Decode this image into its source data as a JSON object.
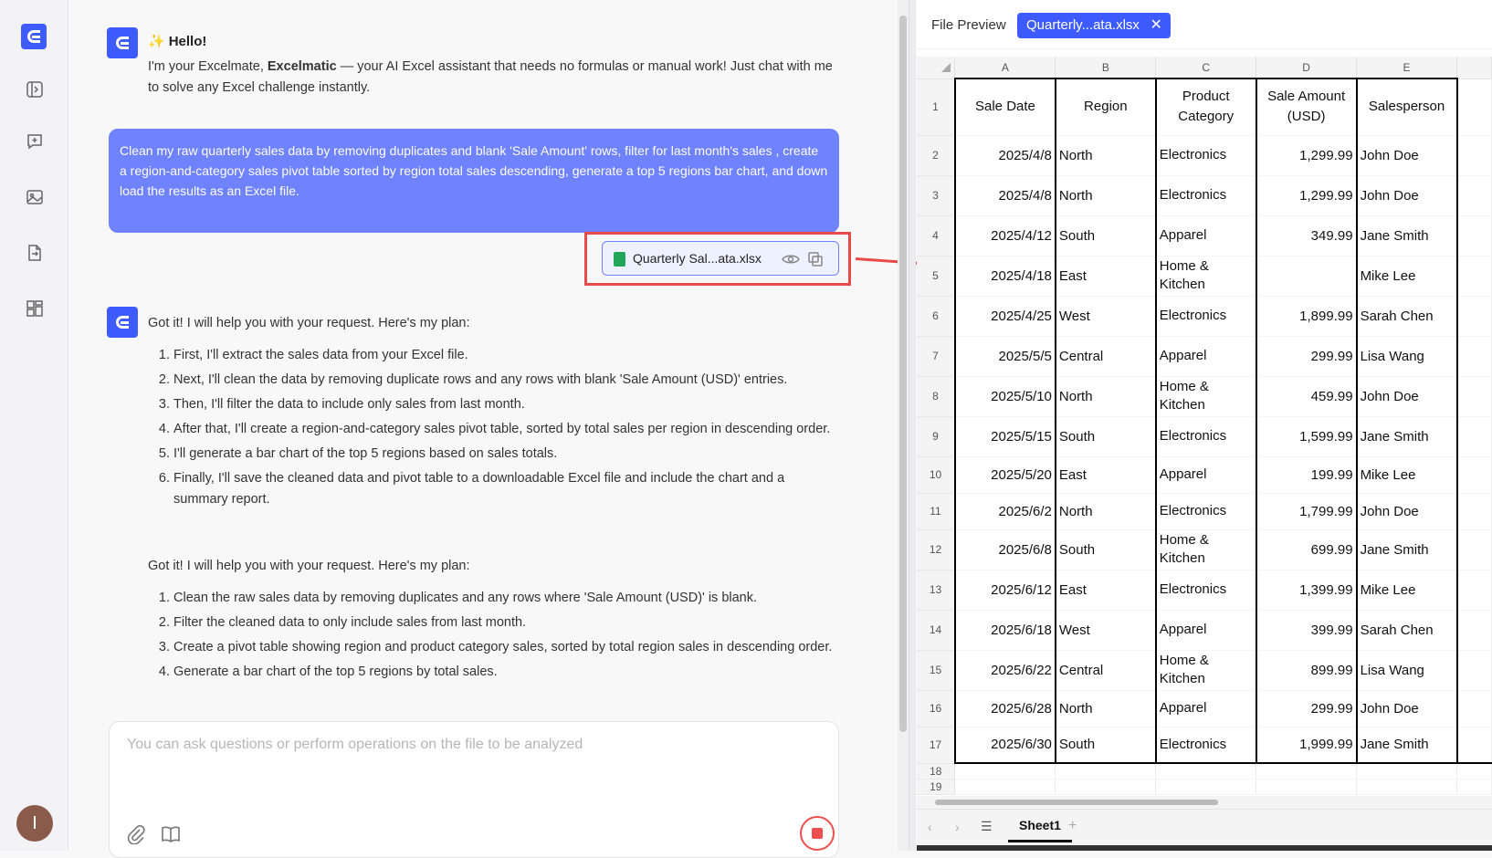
{
  "chat": {
    "hello_title": "Hello!",
    "hello_pre": "I'm your Excelmate, ",
    "hello_brand": "Excelmatic",
    "hello_post": " — your AI Excel assistant that needs no formulas or manual work! Just chat with me to solve any Excel challenge instantly.",
    "user_message": "Clean my raw quarterly sales data by removing duplicates and blank 'Sale Amount' rows, filter for last month's sales , create a region-and-category sales pivot table sorted by region total sales descending, generate a top 5 regions bar chart, and download the results as an Excel file.",
    "attached_file": "Quarterly Sal...ata.xlsx",
    "plan1_intro": "Got it! I will help you with your request. Here's my plan:",
    "plan1_items": [
      "First, I'll extract the sales data from your Excel file.",
      "Next, I'll clean the data by removing duplicate rows and any rows with blank 'Sale Amount (USD)' entries.",
      "Then, I'll filter the data to include only sales from last month.",
      "After that, I'll create a region-and-category sales pivot table, sorted by total sales per region in descending order.",
      "I'll generate a bar chart of the top 5 regions based on sales totals.",
      "Finally, I'll save the cleaned data and pivot table to a downloadable Excel file and include the chart and a summary report."
    ],
    "plan2_intro": "Got it! I will help you with your request. Here's my plan:",
    "plan2_items": [
      "Clean the raw sales data by removing duplicates and any rows where 'Sale Amount (USD)' is blank.",
      "Filter the cleaned data to only include sales from last month.",
      "Create a pivot table showing region and product category sales, sorted by total region sales in descending order.",
      "Generate a bar chart of the top 5 regions by total sales."
    ],
    "input_placeholder": "You can ask questions or perform operations on the file to be analyzed"
  },
  "user": {
    "avatar_initial": "I"
  },
  "preview": {
    "label": "File Preview",
    "tab_name": "Quarterly...ata.xlsx",
    "tab_close": "✕",
    "columns": [
      "A",
      "B",
      "C",
      "D",
      "E"
    ],
    "headers": [
      "Sale Date",
      "Region",
      "Product Category",
      "Sale Amount (USD)",
      "Salesperson"
    ],
    "rows": [
      [
        "2025/4/8",
        "North",
        "Electronics",
        "1,299.99",
        "John Doe"
      ],
      [
        "2025/4/8",
        "North",
        "Electronics",
        "1,299.99",
        "John Doe"
      ],
      [
        "2025/4/12",
        "South",
        "Apparel",
        "349.99",
        "Jane Smith"
      ],
      [
        "2025/4/18",
        "East",
        "Home & Kitchen",
        "",
        "Mike Lee"
      ],
      [
        "2025/4/25",
        "West",
        "Electronics",
        "1,899.99",
        "Sarah Chen"
      ],
      [
        "2025/5/5",
        "Central",
        "Apparel",
        "299.99",
        "Lisa Wang"
      ],
      [
        "2025/5/10",
        "North",
        "Home & Kitchen",
        "459.99",
        "John Doe"
      ],
      [
        "2025/5/15",
        "South",
        "Electronics",
        "1,599.99",
        "Jane Smith"
      ],
      [
        "2025/5/20",
        "East",
        "Apparel",
        "199.99",
        "Mike Lee"
      ],
      [
        "2025/6/2",
        "North",
        "Electronics",
        "1,799.99",
        "John Doe"
      ],
      [
        "2025/6/8",
        "South",
        "Home & Kitchen",
        "699.99",
        "Jane Smith"
      ],
      [
        "2025/6/12",
        "East",
        "Electronics",
        "1,399.99",
        "Mike Lee"
      ],
      [
        "2025/6/18",
        "West",
        "Apparel",
        "399.99",
        "Sarah Chen"
      ],
      [
        "2025/6/22",
        "Central",
        "Home & Kitchen",
        "899.99",
        "Lisa Wang"
      ],
      [
        "2025/6/28",
        "North",
        "Apparel",
        "299.99",
        "John Doe"
      ],
      [
        "2025/6/30",
        "South",
        "Electronics",
        "1,999.99",
        "Jane Smith"
      ]
    ],
    "empty_row_numbers": [
      "18",
      "19"
    ],
    "sheet_name": "Sheet1",
    "sheet_add": "+",
    "nav_prev": "‹",
    "nav_next": "›",
    "sheet_menu": "☰"
  },
  "colors": {
    "accent": "#3e5bff",
    "user_bubble": "#6f82ff",
    "highlight": "#e84a4a",
    "excel_green": "#23a55a"
  }
}
